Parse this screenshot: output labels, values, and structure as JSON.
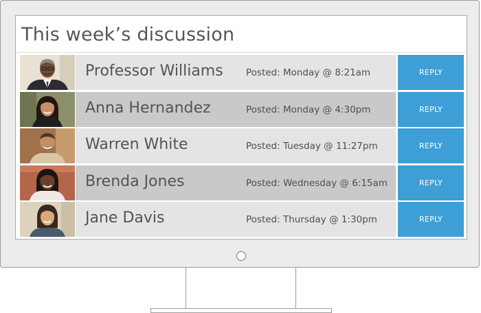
{
  "title": "This week’s discussion",
  "posts": [
    {
      "name": "Professor Williams",
      "posted": "Posted: Monday @ 8:21am",
      "reply_label": "REPLY",
      "shade": "light",
      "avatar": "avatar-photo-professor-williams"
    },
    {
      "name": "Anna Hernandez",
      "posted": "Posted: Monday @ 4:30pm",
      "reply_label": "REPLY",
      "shade": "dark",
      "avatar": "avatar-photo-anna-hernandez"
    },
    {
      "name": "Warren White",
      "posted": "Posted: Tuesday @ 11:27pm",
      "reply_label": "REPLY",
      "shade": "light",
      "avatar": "avatar-photo-warren-white"
    },
    {
      "name": "Brenda Jones",
      "posted": "Posted: Wednesday @ 6:15am",
      "reply_label": "REPLY",
      "shade": "dark",
      "avatar": "avatar-photo-brenda-jones"
    },
    {
      "name": "Jane Davis",
      "posted": "Posted: Thursday @ 1:30pm",
      "reply_label": "REPLY",
      "shade": "light",
      "avatar": "avatar-photo-jane-davis"
    }
  ],
  "colors": {
    "reply_button": "#3e9fd6",
    "row_light": "#e4e4e4",
    "row_dark": "#c9c9c9",
    "text": "#545454"
  }
}
